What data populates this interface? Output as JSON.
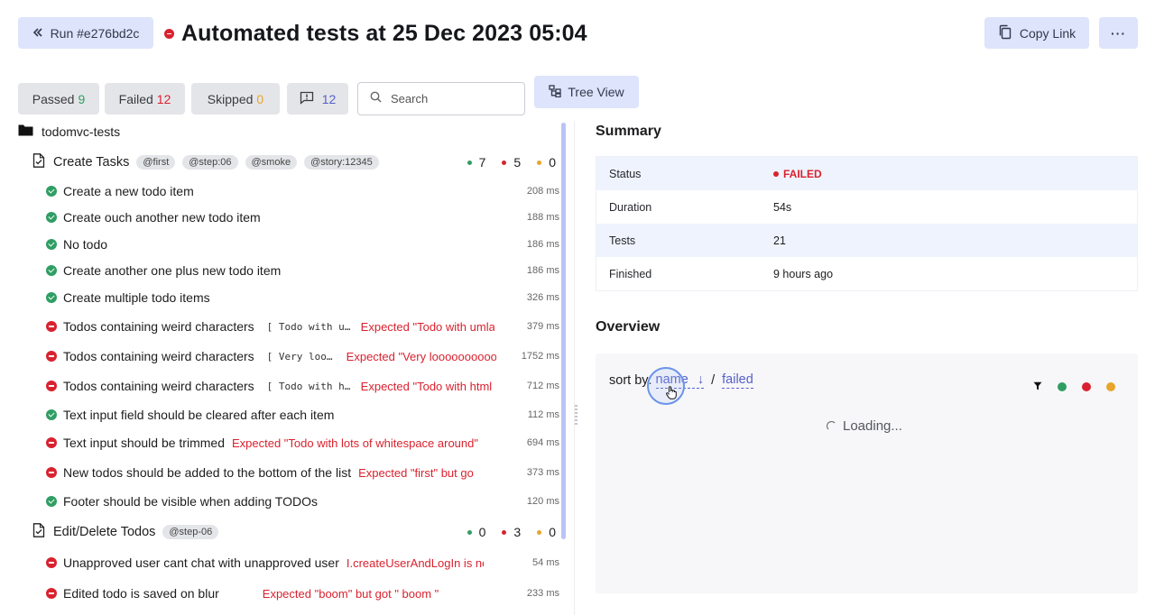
{
  "header": {
    "run_label": "Run #e276bd2c",
    "title": "Automated tests at 25 Dec 2023 05:04",
    "copy_link_label": "Copy Link",
    "more_label": "···"
  },
  "filters": {
    "passed_label": "Passed",
    "passed_count": "9",
    "failed_label": "Failed",
    "failed_count": "12",
    "skipped_label": "Skipped",
    "skipped_count": "0",
    "messages_count": "12",
    "search_placeholder": "Search",
    "tree_view_label": "Tree View"
  },
  "tree": {
    "root": "todomvc-tests",
    "suites": [
      {
        "name": "Create Tasks",
        "tags": [
          "@first",
          "@step:06",
          "@smoke",
          "@story:12345"
        ],
        "passed": "7",
        "failed": "5",
        "skipped": "0"
      },
      {
        "name": "Edit/Delete Todos",
        "tags": [
          "@step-06"
        ],
        "passed": "0",
        "failed": "3",
        "skipped": "0"
      }
    ],
    "tests": [
      {
        "status": "pass",
        "name": "Create a new todo item",
        "param": "",
        "error": "",
        "duration": "208 ms"
      },
      {
        "status": "pass",
        "name": "Create ouch another new todo item",
        "param": "",
        "error": "",
        "duration": "188 ms"
      },
      {
        "status": "pass",
        "name": "No todo",
        "param": "",
        "error": "",
        "duration": "186 ms"
      },
      {
        "status": "pass",
        "name": "Create another one plus new todo item",
        "param": "",
        "error": "",
        "duration": "186 ms"
      },
      {
        "status": "pass",
        "name": "Create multiple todo items",
        "param": "",
        "error": "",
        "duration": "326 ms"
      },
      {
        "status": "fail",
        "name": "Todos containing weird characters",
        "param": "[ Todo with u…",
        "error": "Expected \"Todo with umlaut",
        "duration": "379 ms"
      },
      {
        "status": "fail",
        "name": "Todos containing weird characters",
        "param": "[ Very loo…",
        "error": "Expected \"Very looooooooooc",
        "duration": "1752 ms"
      },
      {
        "status": "fail",
        "name": "Todos containing weird characters",
        "param": "[ Todo with h…",
        "error": "Expected \"Todo with html c",
        "duration": "712 ms"
      },
      {
        "status": "pass",
        "name": "Text input field should be cleared after each item",
        "param": "",
        "error": "",
        "duration": "112 ms"
      },
      {
        "status": "fail",
        "name": "Text input should be trimmed",
        "param": "",
        "error": "Expected \"Todo with lots of whitespace around\"",
        "duration": "694 ms"
      },
      {
        "status": "fail",
        "name": "New todos should be added to the bottom of the list",
        "param": "",
        "error": "Expected \"first\" but go",
        "duration": "373 ms"
      },
      {
        "status": "pass",
        "name": "Footer should be visible when adding TODOs",
        "param": "",
        "error": "",
        "duration": "120 ms"
      },
      {
        "status": "fail",
        "name": "Unapproved user cant chat with unapproved user",
        "param": "",
        "error": "I.createUserAndLogIn is no",
        "duration": "54 ms"
      },
      {
        "status": "fail",
        "name": "Edited todo is saved on blur",
        "param": "",
        "error": "Expected \"boom\" but got \" boom \"",
        "duration": "233 ms"
      }
    ]
  },
  "summary": {
    "title": "Summary",
    "rows": [
      {
        "key": "Status",
        "value": "FAILED"
      },
      {
        "key": "Duration",
        "value": "54s"
      },
      {
        "key": "Tests",
        "value": "21"
      },
      {
        "key": "Finished",
        "value": "9 hours ago"
      }
    ]
  },
  "overview": {
    "title": "Overview",
    "sort_prefix": "sort by:",
    "sort_name": "name",
    "sort_arrow": "↓",
    "sort_sep": "/",
    "sort_failed": "failed",
    "loading": "Loading..."
  },
  "colors": {
    "passed": "#2f9e62",
    "failed": "#d9222f",
    "skipped": "#e8a52a",
    "accent": "#5660c9",
    "button_bg": "#dde4fb"
  }
}
